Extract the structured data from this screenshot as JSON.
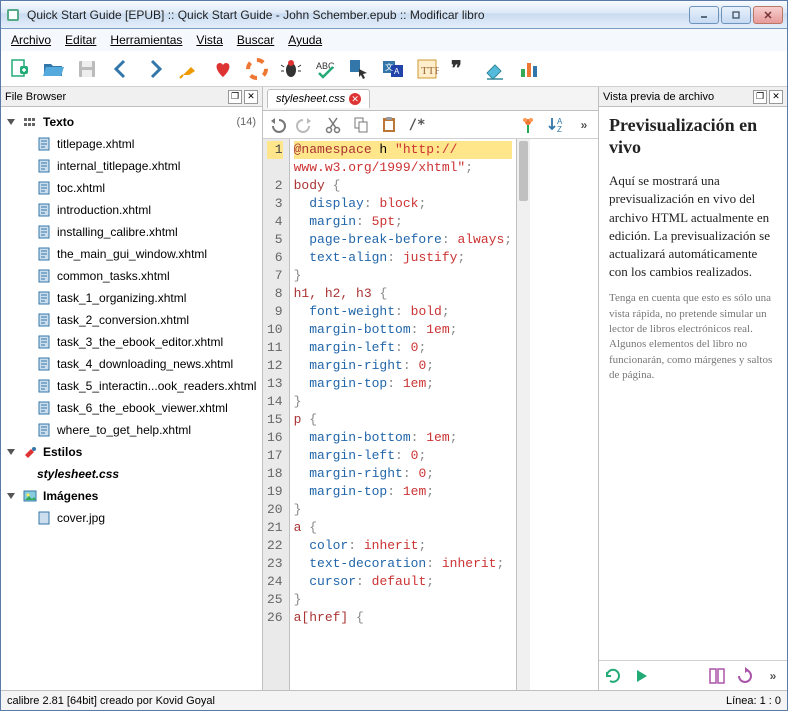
{
  "window": {
    "title": "Quick Start Guide [EPUB] :: Quick Start Guide - John Schember.epub :: Modificar libro"
  },
  "menu": {
    "items": [
      "Archivo",
      "Editar",
      "Herramientas",
      "Vista",
      "Buscar",
      "Ayuda"
    ]
  },
  "filebrowser": {
    "title": "File Browser",
    "categories": [
      {
        "label": "Texto",
        "count": "(14)",
        "files": [
          "titlepage.xhtml",
          "internal_titlepage.xhtml",
          "toc.xhtml",
          "introduction.xhtml",
          "installing_calibre.xhtml",
          "the_main_gui_window.xhtml",
          "common_tasks.xhtml",
          "task_1_organizing.xhtml",
          "task_2_conversion.xhtml",
          "task_3_the_ebook_editor.xhtml",
          "task_4_downloading_news.xhtml",
          "task_5_interactin...ook_readers.xhtml",
          "task_6_the_ebook_viewer.xhtml",
          "where_to_get_help.xhtml"
        ]
      },
      {
        "label": "Estilos",
        "files": [
          "stylesheet.css"
        ],
        "selected": 0
      },
      {
        "label": "Imágenes",
        "files": [
          "cover.jpg"
        ]
      }
    ]
  },
  "editor": {
    "tab": {
      "name": "stylesheet.css"
    },
    "lines": [
      {
        "n": 1,
        "hl": true,
        "seg": [
          [
            "at",
            "@namespace"
          ],
          [
            "txt",
            " h "
          ],
          [
            "str",
            "\"http://"
          ]
        ]
      },
      {
        "n": null,
        "seg": [
          [
            "str",
            "www.w3.org/1999/xhtml\""
          ],
          [
            "punc",
            ";"
          ]
        ]
      },
      {
        "n": 2,
        "seg": [
          [
            "sel",
            "body"
          ],
          [
            "txt",
            " "
          ],
          [
            "punc",
            "{"
          ]
        ]
      },
      {
        "n": 3,
        "seg": [
          [
            "txt",
            "  "
          ],
          [
            "prop",
            "display"
          ],
          [
            "punc",
            ": "
          ],
          [
            "val",
            "block"
          ],
          [
            "punc",
            ";"
          ]
        ]
      },
      {
        "n": 4,
        "seg": [
          [
            "txt",
            "  "
          ],
          [
            "prop",
            "margin"
          ],
          [
            "punc",
            ": "
          ],
          [
            "num",
            "5pt"
          ],
          [
            "punc",
            ";"
          ]
        ]
      },
      {
        "n": 5,
        "seg": [
          [
            "txt",
            "  "
          ],
          [
            "prop",
            "page-break-before"
          ],
          [
            "punc",
            ": "
          ],
          [
            "val",
            "always"
          ],
          [
            "punc",
            ";"
          ]
        ]
      },
      {
        "n": 6,
        "seg": [
          [
            "txt",
            "  "
          ],
          [
            "prop",
            "text-align"
          ],
          [
            "punc",
            ": "
          ],
          [
            "val",
            "justify"
          ],
          [
            "punc",
            ";"
          ]
        ]
      },
      {
        "n": 7,
        "seg": [
          [
            "punc",
            "}"
          ]
        ]
      },
      {
        "n": 8,
        "seg": [
          [
            "sel",
            "h1, h2, h3"
          ],
          [
            "txt",
            " "
          ],
          [
            "punc",
            "{"
          ]
        ]
      },
      {
        "n": 9,
        "seg": [
          [
            "txt",
            "  "
          ],
          [
            "prop",
            "font-weight"
          ],
          [
            "punc",
            ": "
          ],
          [
            "val",
            "bold"
          ],
          [
            "punc",
            ";"
          ]
        ]
      },
      {
        "n": 10,
        "seg": [
          [
            "txt",
            "  "
          ],
          [
            "prop",
            "margin-bottom"
          ],
          [
            "punc",
            ": "
          ],
          [
            "num",
            "1em"
          ],
          [
            "punc",
            ";"
          ]
        ]
      },
      {
        "n": 11,
        "seg": [
          [
            "txt",
            "  "
          ],
          [
            "prop",
            "margin-left"
          ],
          [
            "punc",
            ": "
          ],
          [
            "num",
            "0"
          ],
          [
            "punc",
            ";"
          ]
        ]
      },
      {
        "n": 12,
        "seg": [
          [
            "txt",
            "  "
          ],
          [
            "prop",
            "margin-right"
          ],
          [
            "punc",
            ": "
          ],
          [
            "num",
            "0"
          ],
          [
            "punc",
            ";"
          ]
        ]
      },
      {
        "n": 13,
        "seg": [
          [
            "txt",
            "  "
          ],
          [
            "prop",
            "margin-top"
          ],
          [
            "punc",
            ": "
          ],
          [
            "num",
            "1em"
          ],
          [
            "punc",
            ";"
          ]
        ]
      },
      {
        "n": 14,
        "seg": [
          [
            "punc",
            "}"
          ]
        ]
      },
      {
        "n": 15,
        "seg": [
          [
            "sel",
            "p"
          ],
          [
            "txt",
            " "
          ],
          [
            "punc",
            "{"
          ]
        ]
      },
      {
        "n": 16,
        "seg": [
          [
            "txt",
            "  "
          ],
          [
            "prop",
            "margin-bottom"
          ],
          [
            "punc",
            ": "
          ],
          [
            "num",
            "1em"
          ],
          [
            "punc",
            ";"
          ]
        ]
      },
      {
        "n": 17,
        "seg": [
          [
            "txt",
            "  "
          ],
          [
            "prop",
            "margin-left"
          ],
          [
            "punc",
            ": "
          ],
          [
            "num",
            "0"
          ],
          [
            "punc",
            ";"
          ]
        ]
      },
      {
        "n": 18,
        "seg": [
          [
            "txt",
            "  "
          ],
          [
            "prop",
            "margin-right"
          ],
          [
            "punc",
            ": "
          ],
          [
            "num",
            "0"
          ],
          [
            "punc",
            ";"
          ]
        ]
      },
      {
        "n": 19,
        "seg": [
          [
            "txt",
            "  "
          ],
          [
            "prop",
            "margin-top"
          ],
          [
            "punc",
            ": "
          ],
          [
            "num",
            "1em"
          ],
          [
            "punc",
            ";"
          ]
        ]
      },
      {
        "n": 20,
        "seg": [
          [
            "punc",
            "}"
          ]
        ]
      },
      {
        "n": 21,
        "seg": [
          [
            "sel",
            "a"
          ],
          [
            "txt",
            " "
          ],
          [
            "punc",
            "{"
          ]
        ]
      },
      {
        "n": 22,
        "seg": [
          [
            "txt",
            "  "
          ],
          [
            "prop",
            "color"
          ],
          [
            "punc",
            ": "
          ],
          [
            "val",
            "inherit"
          ],
          [
            "punc",
            ";"
          ]
        ]
      },
      {
        "n": 23,
        "seg": [
          [
            "txt",
            "  "
          ],
          [
            "prop",
            "text-decoration"
          ],
          [
            "punc",
            ": "
          ],
          [
            "val",
            "inherit"
          ],
          [
            "punc",
            ";"
          ]
        ]
      },
      {
        "n": 24,
        "seg": [
          [
            "txt",
            "  "
          ],
          [
            "prop",
            "cursor"
          ],
          [
            "punc",
            ": "
          ],
          [
            "val",
            "default"
          ],
          [
            "punc",
            ";"
          ]
        ]
      },
      {
        "n": 25,
        "seg": [
          [
            "punc",
            "}"
          ]
        ]
      },
      {
        "n": 26,
        "seg": [
          [
            "sel",
            "a[href]"
          ],
          [
            "txt",
            " "
          ],
          [
            "punc",
            "{"
          ]
        ]
      }
    ]
  },
  "preview": {
    "title": "Vista previa de archivo",
    "heading": "Previsualización en vivo",
    "body": "Aquí se mostrará una previsualización en vivo del archivo HTML actualmente en edición. La previsualización se actualizará automáticamente con los cambios realizados.",
    "note": "Tenga en cuenta que esto es sólo una vista rápida, no pretende simular un lector de libros electrónicos real. Algunos elementos del libro no funcionarán, como márgenes y saltos de página."
  },
  "status": {
    "left": "calibre 2.81 [64bit] creado por Kovid Goyal",
    "right": "Línea: 1 : 0"
  }
}
